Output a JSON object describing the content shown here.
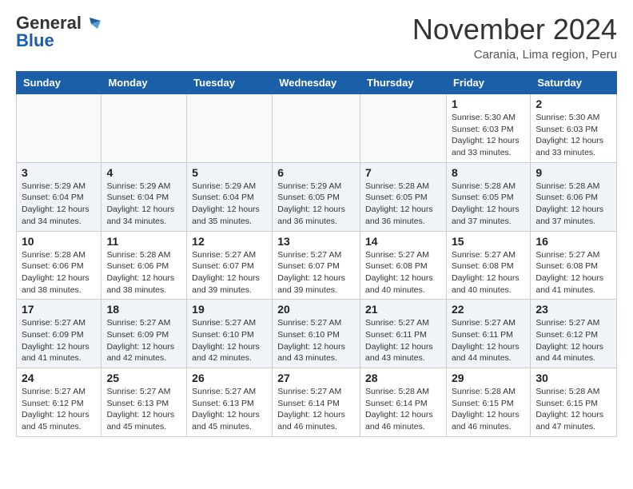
{
  "header": {
    "logo_line1": "General",
    "logo_line2": "Blue",
    "month_title": "November 2024",
    "location": "Carania, Lima region, Peru"
  },
  "weekdays": [
    "Sunday",
    "Monday",
    "Tuesday",
    "Wednesday",
    "Thursday",
    "Friday",
    "Saturday"
  ],
  "weeks": [
    [
      {
        "day": "",
        "info": ""
      },
      {
        "day": "",
        "info": ""
      },
      {
        "day": "",
        "info": ""
      },
      {
        "day": "",
        "info": ""
      },
      {
        "day": "",
        "info": ""
      },
      {
        "day": "1",
        "info": "Sunrise: 5:30 AM\nSunset: 6:03 PM\nDaylight: 12 hours\nand 33 minutes."
      },
      {
        "day": "2",
        "info": "Sunrise: 5:30 AM\nSunset: 6:03 PM\nDaylight: 12 hours\nand 33 minutes."
      }
    ],
    [
      {
        "day": "3",
        "info": "Sunrise: 5:29 AM\nSunset: 6:04 PM\nDaylight: 12 hours\nand 34 minutes."
      },
      {
        "day": "4",
        "info": "Sunrise: 5:29 AM\nSunset: 6:04 PM\nDaylight: 12 hours\nand 34 minutes."
      },
      {
        "day": "5",
        "info": "Sunrise: 5:29 AM\nSunset: 6:04 PM\nDaylight: 12 hours\nand 35 minutes."
      },
      {
        "day": "6",
        "info": "Sunrise: 5:29 AM\nSunset: 6:05 PM\nDaylight: 12 hours\nand 36 minutes."
      },
      {
        "day": "7",
        "info": "Sunrise: 5:28 AM\nSunset: 6:05 PM\nDaylight: 12 hours\nand 36 minutes."
      },
      {
        "day": "8",
        "info": "Sunrise: 5:28 AM\nSunset: 6:05 PM\nDaylight: 12 hours\nand 37 minutes."
      },
      {
        "day": "9",
        "info": "Sunrise: 5:28 AM\nSunset: 6:06 PM\nDaylight: 12 hours\nand 37 minutes."
      }
    ],
    [
      {
        "day": "10",
        "info": "Sunrise: 5:28 AM\nSunset: 6:06 PM\nDaylight: 12 hours\nand 38 minutes."
      },
      {
        "day": "11",
        "info": "Sunrise: 5:28 AM\nSunset: 6:06 PM\nDaylight: 12 hours\nand 38 minutes."
      },
      {
        "day": "12",
        "info": "Sunrise: 5:27 AM\nSunset: 6:07 PM\nDaylight: 12 hours\nand 39 minutes."
      },
      {
        "day": "13",
        "info": "Sunrise: 5:27 AM\nSunset: 6:07 PM\nDaylight: 12 hours\nand 39 minutes."
      },
      {
        "day": "14",
        "info": "Sunrise: 5:27 AM\nSunset: 6:08 PM\nDaylight: 12 hours\nand 40 minutes."
      },
      {
        "day": "15",
        "info": "Sunrise: 5:27 AM\nSunset: 6:08 PM\nDaylight: 12 hours\nand 40 minutes."
      },
      {
        "day": "16",
        "info": "Sunrise: 5:27 AM\nSunset: 6:08 PM\nDaylight: 12 hours\nand 41 minutes."
      }
    ],
    [
      {
        "day": "17",
        "info": "Sunrise: 5:27 AM\nSunset: 6:09 PM\nDaylight: 12 hours\nand 41 minutes."
      },
      {
        "day": "18",
        "info": "Sunrise: 5:27 AM\nSunset: 6:09 PM\nDaylight: 12 hours\nand 42 minutes."
      },
      {
        "day": "19",
        "info": "Sunrise: 5:27 AM\nSunset: 6:10 PM\nDaylight: 12 hours\nand 42 minutes."
      },
      {
        "day": "20",
        "info": "Sunrise: 5:27 AM\nSunset: 6:10 PM\nDaylight: 12 hours\nand 43 minutes."
      },
      {
        "day": "21",
        "info": "Sunrise: 5:27 AM\nSunset: 6:11 PM\nDaylight: 12 hours\nand 43 minutes."
      },
      {
        "day": "22",
        "info": "Sunrise: 5:27 AM\nSunset: 6:11 PM\nDaylight: 12 hours\nand 44 minutes."
      },
      {
        "day": "23",
        "info": "Sunrise: 5:27 AM\nSunset: 6:12 PM\nDaylight: 12 hours\nand 44 minutes."
      }
    ],
    [
      {
        "day": "24",
        "info": "Sunrise: 5:27 AM\nSunset: 6:12 PM\nDaylight: 12 hours\nand 45 minutes."
      },
      {
        "day": "25",
        "info": "Sunrise: 5:27 AM\nSunset: 6:13 PM\nDaylight: 12 hours\nand 45 minutes."
      },
      {
        "day": "26",
        "info": "Sunrise: 5:27 AM\nSunset: 6:13 PM\nDaylight: 12 hours\nand 45 minutes."
      },
      {
        "day": "27",
        "info": "Sunrise: 5:27 AM\nSunset: 6:14 PM\nDaylight: 12 hours\nand 46 minutes."
      },
      {
        "day": "28",
        "info": "Sunrise: 5:28 AM\nSunset: 6:14 PM\nDaylight: 12 hours\nand 46 minutes."
      },
      {
        "day": "29",
        "info": "Sunrise: 5:28 AM\nSunset: 6:15 PM\nDaylight: 12 hours\nand 46 minutes."
      },
      {
        "day": "30",
        "info": "Sunrise: 5:28 AM\nSunset: 6:15 PM\nDaylight: 12 hours\nand 47 minutes."
      }
    ]
  ]
}
